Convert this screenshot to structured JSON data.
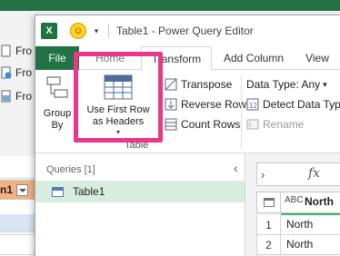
{
  "excel": {
    "buttons": [
      {
        "label": "Fro"
      },
      {
        "label": "Fro"
      },
      {
        "label": "Fro"
      }
    ],
    "column_header": "n1",
    "accent": "#217346",
    "header_fill": "#f4b183"
  },
  "power_query": {
    "logo_text": "X",
    "window_title": "Table1 - Power Query Editor",
    "tabs": [
      {
        "label": "File",
        "active": false
      },
      {
        "label": "Home",
        "active": false
      },
      {
        "label": "Transform",
        "active": true
      },
      {
        "label": "Add Column",
        "active": false
      },
      {
        "label": "View",
        "active": false
      }
    ],
    "ribbon": {
      "group_by": "Group\nBy",
      "use_first_row": "Use First Row\nas Headers",
      "transpose": "Transpose",
      "reverse_rows": "Reverse Rows",
      "count_rows": "Count Rows",
      "data_type": "Data Type: Any",
      "detect_data_type": "Detect Data Type",
      "rename": "Rename",
      "group_label": "Table"
    },
    "queries": {
      "header": "Queries [1]",
      "items": [
        "Table1"
      ]
    },
    "formula_bar": {
      "fx": "fx"
    },
    "grid": {
      "type_label": "ABC",
      "column": "North",
      "rows": [
        {
          "num": "1",
          "value": "North"
        },
        {
          "num": "2",
          "value": "North"
        }
      ]
    },
    "highlight_color": "#e8388a"
  }
}
